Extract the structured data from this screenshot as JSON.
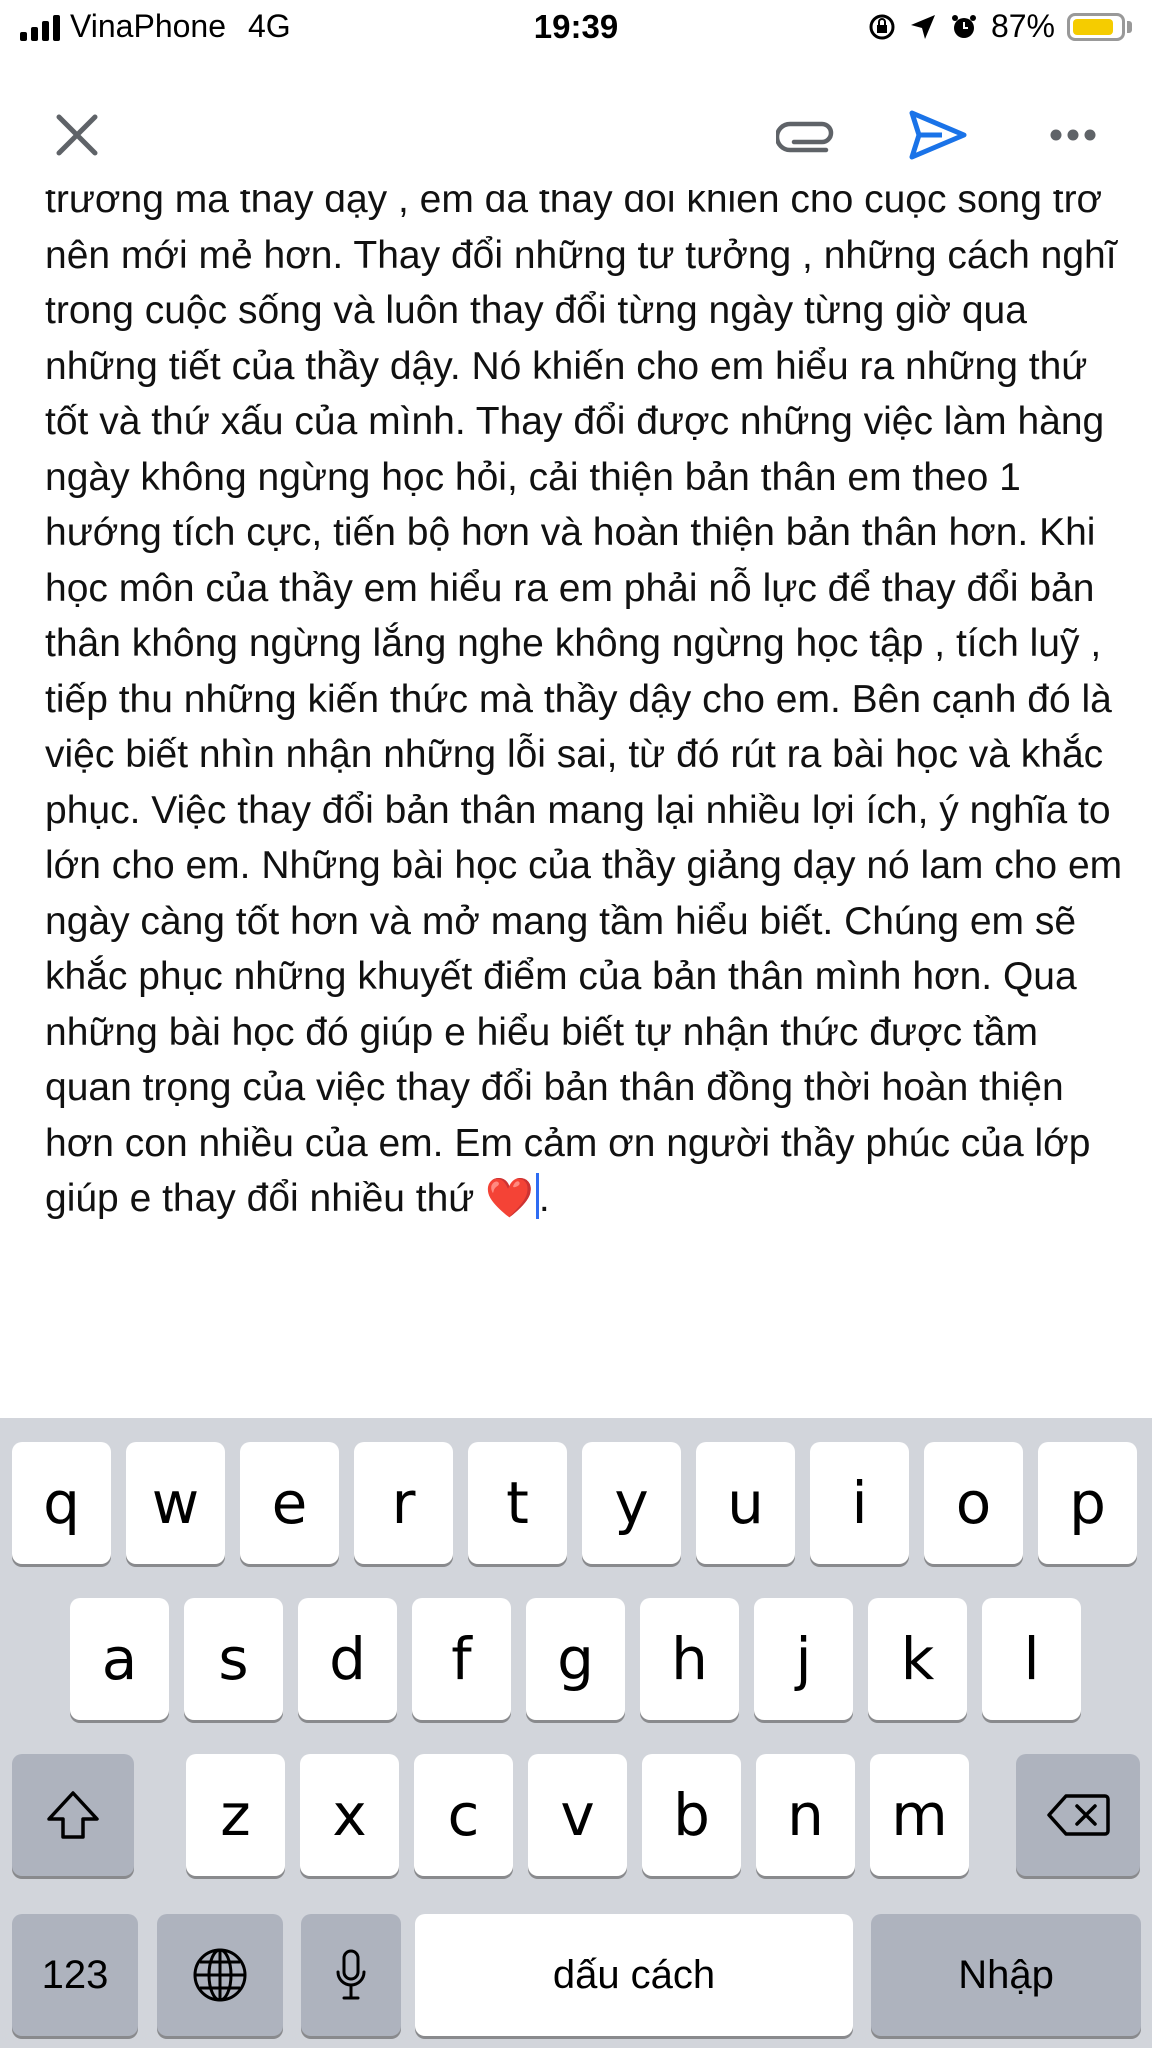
{
  "status_bar": {
    "carrier": "VinaPhone",
    "network": "4G",
    "time": "19:39",
    "battery_percent": "87%",
    "battery_level": 0.87
  },
  "toolbar": {
    "close_icon": "close-icon",
    "attach_icon": "paperclip-icon",
    "send_icon": "send-icon",
    "more_icon": "more-icon",
    "send_color": "#1a73e8"
  },
  "message": {
    "text": "trương mà thầy dậy , em đã thay đổi khiến cho cuộc sống trở nên mới mẻ hơn. Thay đổi những tư tưởng , những cách nghĩ trong cuộc sống và luôn thay đổi từng ngày từng giờ qua những tiết của thầy dậy. Nó khiến cho em hiểu ra những thứ tốt và thứ xấu của mình. Thay đổi được những việc làm hàng ngày không ngừng học hỏi, cải thiện bản thân em theo 1 hướng tích cực, tiến bộ hơn và hoàn thiện bản thân hơn. Khi học môn của thầy em hiểu ra em phải nỗ lực để thay đổi bản thân không ngừng lắng nghe không ngừng học tập , tích luỹ , tiếp thu những kiến thức mà thầy dậy cho em. Bên cạnh đó là việc biết nhìn nhận những lỗi sai, từ đó rút ra bài học và khắc phục. Việc thay đổi bản thân mang lại nhiều lợi ích, ý nghĩa to lớn cho em. Những bài học của thầy giảng dạy nó lam cho em ngày càng tốt hơn và mở mang tầm hiểu biết. Chúng em sẽ khắc phục những khuyết điểm của bản thân mình hơn. Qua những bài học đó giúp e hiểu biết tự nhận thức được tầm quan trọng của việc thay đổi bản thân đồng thời hoàn thiện hơn con nhiều của em. Em cảm ơn người thầy phúc của lớp giúp e thay đổi nhiều thứ",
    "emoji": "❤️",
    "end_char": "."
  },
  "keyboard": {
    "row1": [
      "q",
      "w",
      "e",
      "r",
      "t",
      "y",
      "u",
      "i",
      "o",
      "p"
    ],
    "row2": [
      "a",
      "s",
      "d",
      "f",
      "g",
      "h",
      "j",
      "k",
      "l"
    ],
    "row3": [
      "z",
      "x",
      "c",
      "v",
      "b",
      "n",
      "m"
    ],
    "numbers_label": "123",
    "space_label": "dấu cách",
    "return_label": "Nhập",
    "shift_icon": "shift-icon",
    "backspace_icon": "backspace-icon",
    "globe_icon": "globe-icon",
    "mic_icon": "microphone-icon"
  }
}
